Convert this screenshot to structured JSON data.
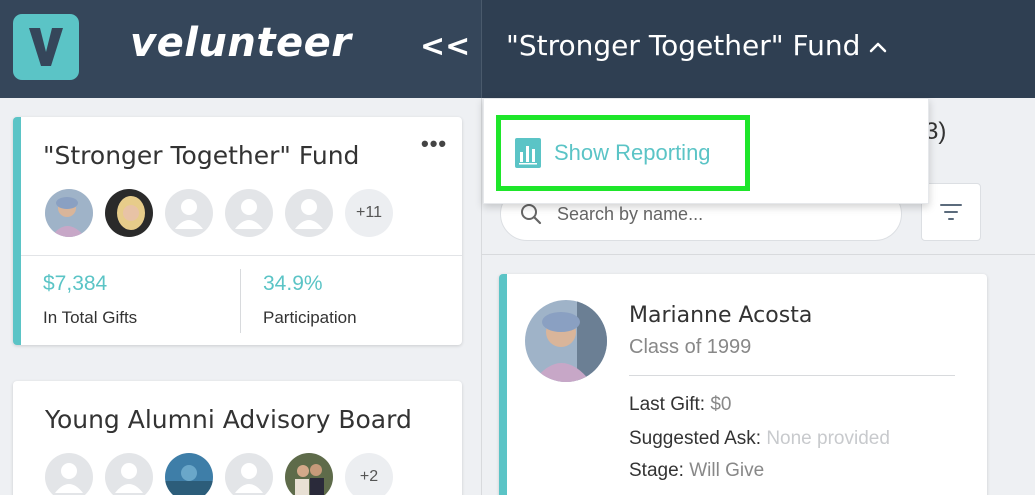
{
  "app": {
    "brand": "velunteer",
    "collapse_label": "<<",
    "accent_color": "#5bc4c6",
    "header_color": "#35465a"
  },
  "header": {
    "title": "\"Stronger Together\" Fund",
    "chevron_icon": "chevron-up-icon"
  },
  "sidebar": {
    "cards": [
      {
        "title": "\"Stronger Together\" Fund",
        "more_label": "•••",
        "avatars_more": "+11",
        "stats": [
          {
            "value": "$7,384",
            "label": "In Total Gifts"
          },
          {
            "value": "34.9%",
            "label": "Participation"
          }
        ]
      },
      {
        "title": "Young Alumni Advisory Board",
        "avatars_more": "+2"
      }
    ]
  },
  "dropdown": {
    "items": [
      {
        "label": "Show Reporting",
        "icon": "bar-chart-icon"
      }
    ],
    "highlight_color": "#1ee62a"
  },
  "panel": {
    "count_suffix": "3)",
    "search": {
      "placeholder": "Search by name..."
    },
    "filter_icon": "filter-icon",
    "contact": {
      "name": "Marianne Acosta",
      "class": "Class of 1999",
      "fields": [
        {
          "label": "Last Gift:",
          "value": "$0"
        },
        {
          "label": "Suggested Ask:",
          "value": "None provided"
        },
        {
          "label": "Stage:",
          "value": "Will Give"
        }
      ]
    }
  }
}
